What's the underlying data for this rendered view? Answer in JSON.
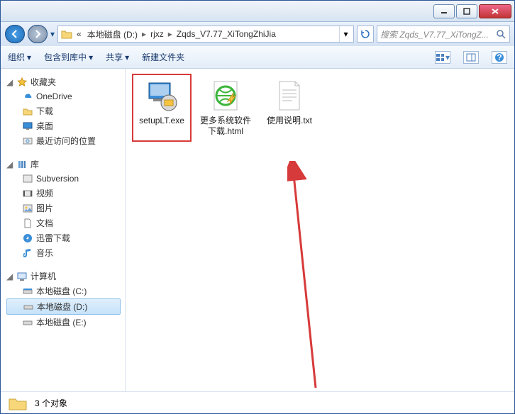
{
  "breadcrumbs": {
    "ellipsis": "«",
    "parts": [
      "本地磁盘 (D:)",
      "rjxz",
      "Zqds_V7.77_XiTongZhiJia"
    ]
  },
  "search": {
    "placeholder": "搜索 Zqds_V7.77_XiTongZ..."
  },
  "toolbar": {
    "organize": "组织",
    "include": "包含到库中",
    "share": "共享",
    "newfolder": "新建文件夹"
  },
  "sidebar": {
    "favorites": {
      "label": "收藏夹",
      "items": [
        "OneDrive",
        "下载",
        "桌面",
        "最近访问的位置"
      ]
    },
    "libraries": {
      "label": "库",
      "items": [
        "Subversion",
        "视频",
        "图片",
        "文档",
        "迅雷下载",
        "音乐"
      ]
    },
    "computer": {
      "label": "计算机",
      "items": [
        "本地磁盘 (C:)",
        "本地磁盘 (D:)",
        "本地磁盘 (E:)"
      ]
    }
  },
  "files": [
    {
      "name": "setupLT.exe"
    },
    {
      "name": "更多系统软件下载.html"
    },
    {
      "name": "使用说明.txt"
    }
  ],
  "status": {
    "text": "3 个对象"
  }
}
